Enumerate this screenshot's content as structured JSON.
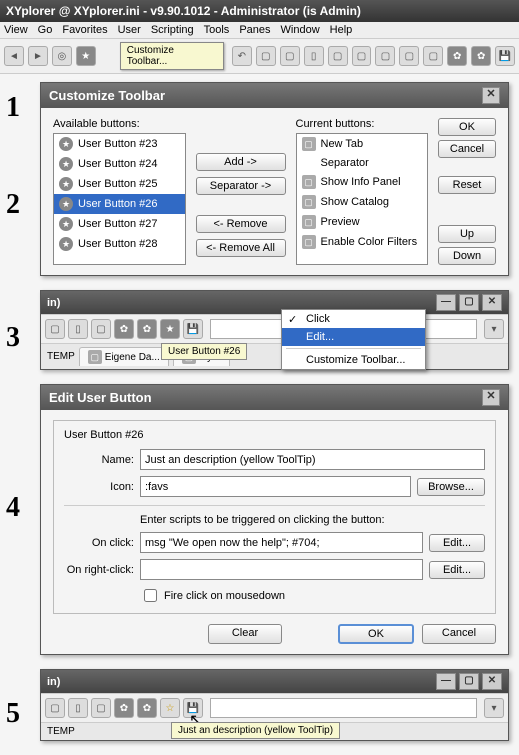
{
  "title": "XYplorer @ XYplorer.ini - v9.90.1012 - Administrator (is Admin)",
  "menu": [
    "View",
    "Go",
    "Favorites",
    "User",
    "Scripting",
    "Tools",
    "Panes",
    "Window",
    "Help"
  ],
  "tooltip_customize": "Customize Toolbar...",
  "dlg1": {
    "title": "Customize Toolbar",
    "avail_label": "Available buttons:",
    "curr_label": "Current buttons:",
    "avail": [
      "User Button #23",
      "User Button #24",
      "User Button #25",
      "User Button #26",
      "User Button #27",
      "User Button #28"
    ],
    "curr": [
      "New Tab",
      "Separator",
      "Show Info Panel",
      "Show Catalog",
      "Preview",
      "Enable Color Filters"
    ],
    "btns": {
      "add": "Add ->",
      "sep": "Separator ->",
      "rem": "<- Remove",
      "remall": "<- Remove All",
      "ok": "OK",
      "cancel": "Cancel",
      "reset": "Reset",
      "up": "Up",
      "down": "Down"
    }
  },
  "panel": {
    "title": "in)",
    "tip": "User Button #26"
  },
  "ctx": {
    "click": "Click",
    "edit": "Edit...",
    "cust": "Customize Toolbar..."
  },
  "tabs": {
    "temp": "TEMP",
    "t1": "Eigene Da...",
    "t2": "MyFi"
  },
  "dlg2": {
    "title": "Edit User Button",
    "header": "User Button #26",
    "name_l": "Name:",
    "name_v": "Just an description (yellow ToolTip)",
    "icon_l": "Icon:",
    "icon_v": ":favs",
    "browse": "Browse...",
    "script_l": "Enter scripts to be triggered on clicking the button:",
    "onclick_l": "On click:",
    "onclick_v": "msg \"We open now the help\"; #704;",
    "onrclick_l": "On right-click:",
    "onrclick_v": "",
    "edit": "Edit...",
    "fire": "Fire click on mousedown",
    "clear": "Clear",
    "ok": "OK",
    "cancel": "Cancel"
  },
  "tip5": "Just an description (yellow ToolTip)"
}
